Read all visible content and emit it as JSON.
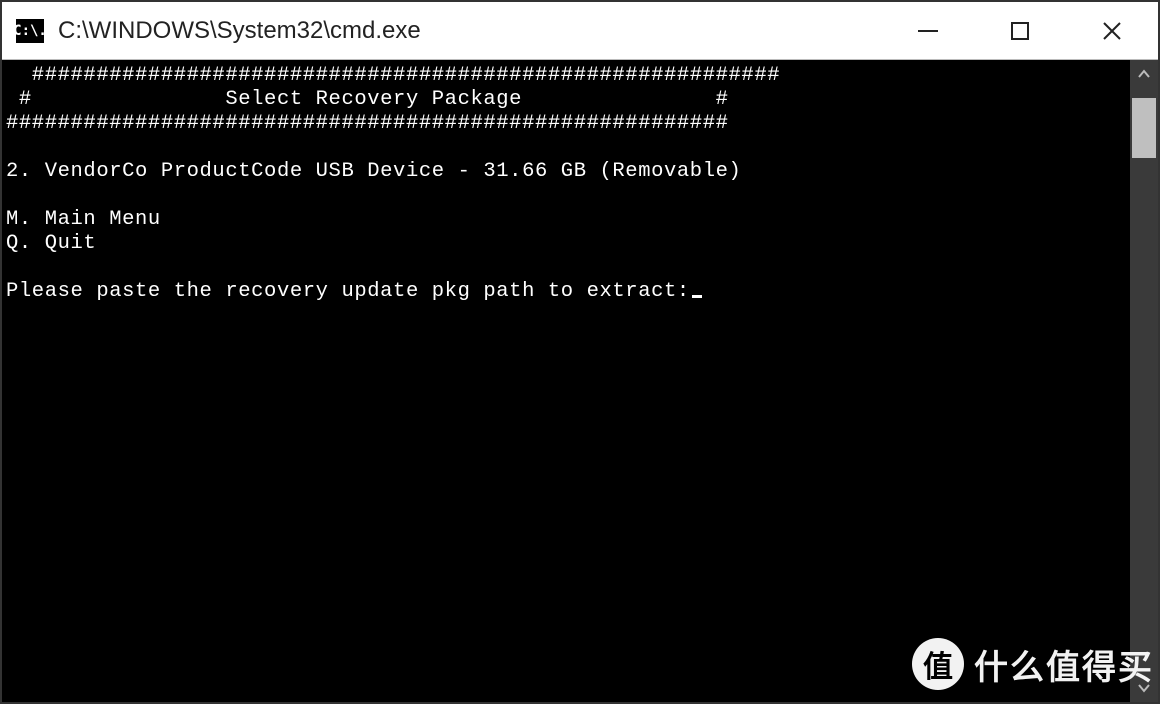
{
  "window": {
    "title": "C:\\WINDOWS\\System32\\cmd.exe",
    "icon_label": "C:\\."
  },
  "terminal": {
    "border_top": "  ##########################################################",
    "heading_line": " #               Select Recovery Package               #",
    "border_bottom": "########################################################",
    "device_line": "2. VendorCo ProductCode USB Device - 31.66 GB (Removable)",
    "menu_main": "M. Main Menu",
    "menu_quit": "Q. Quit",
    "prompt": "Please paste the recovery update pkg path to extract:"
  },
  "watermark": {
    "badge": "值",
    "text": "什么值得买"
  }
}
